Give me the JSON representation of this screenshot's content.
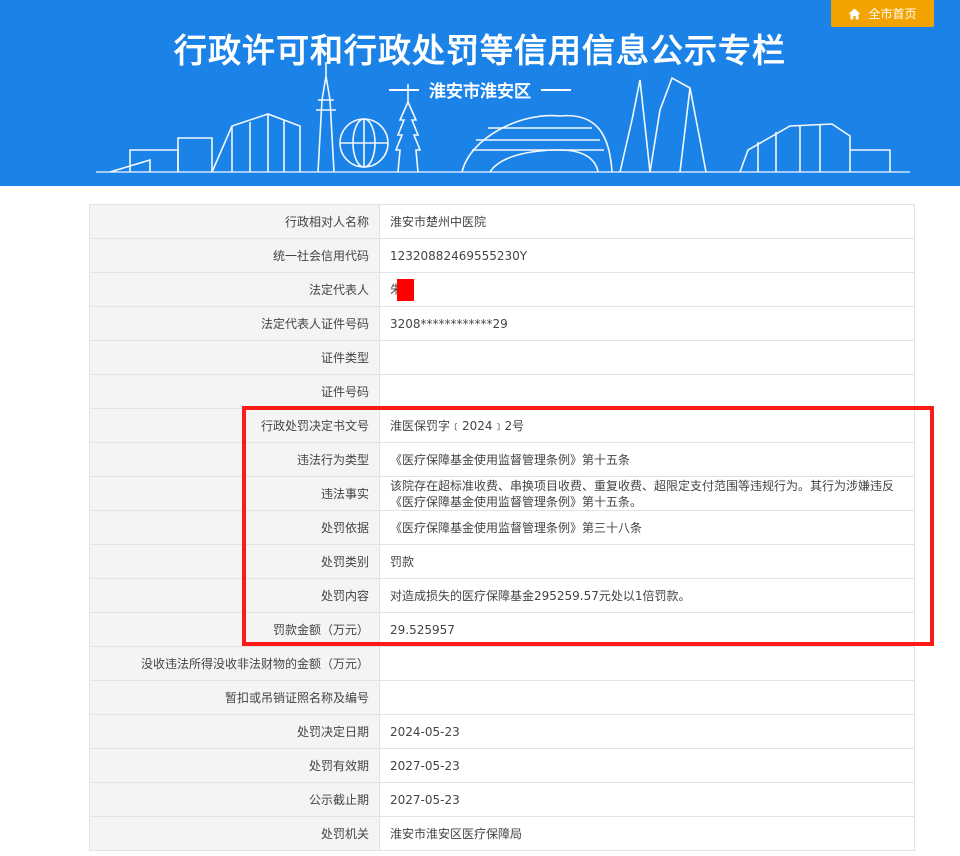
{
  "header": {
    "title": "行政许可和行政处罚等信用信息公示专栏",
    "subtitle": "淮安市淮安区",
    "home_button": "全市首页",
    "home_icon": "home-icon"
  },
  "colors": {
    "banner": "#1b82e8",
    "home_button": "#f3a300",
    "highlight": "#ff1a1a"
  },
  "rows": [
    {
      "label": "行政相对人名称",
      "value": "淮安市楚州中医院"
    },
    {
      "label": "统一社会信用代码",
      "value": "12320882469555230Y"
    },
    {
      "label": "法定代表人",
      "value": "朱"
    },
    {
      "label": "法定代表人证件号码",
      "value": "3208************29"
    },
    {
      "label": "证件类型",
      "value": ""
    },
    {
      "label": "证件号码",
      "value": ""
    },
    {
      "label": "行政处罚决定书文号",
      "value": "淮医保罚字﹝2024﹞2号"
    },
    {
      "label": "违法行为类型",
      "value": "《医疗保障基金使用监督管理条例》第十五条"
    },
    {
      "label": "违法事实",
      "value": "该院存在超标准收费、串换项目收费、重复收费、超限定支付范围等违规行为。其行为涉嫌违反《医疗保障基金使用监督管理条例》第十五条。"
    },
    {
      "label": "处罚依据",
      "value": "《医疗保障基金使用监督管理条例》第三十八条"
    },
    {
      "label": "处罚类别",
      "value": "罚款"
    },
    {
      "label": "处罚内容",
      "value": "对造成损失的医疗保障基金295259.57元处以1倍罚款。"
    },
    {
      "label": "罚款金额（万元）",
      "value": "29.525957"
    },
    {
      "label": "没收违法所得没收非法财物的金额（万元）",
      "value": ""
    },
    {
      "label": "暂扣或吊销证照名称及编号",
      "value": ""
    },
    {
      "label": "处罚决定日期",
      "value": "2024-05-23"
    },
    {
      "label": "处罚有效期",
      "value": "2027-05-23"
    },
    {
      "label": "公示截止期",
      "value": "2027-05-23"
    },
    {
      "label": "处罚机关",
      "value": "淮安市淮安区医疗保障局"
    }
  ]
}
